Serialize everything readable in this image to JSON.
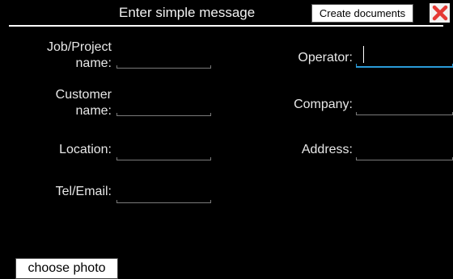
{
  "header": {
    "title": "Enter simple message",
    "create_label": "Create documents"
  },
  "left_fields": {
    "job_project_line1": "Job/Project",
    "job_project_line2": "name:",
    "customer_line1": "Customer",
    "customer_line2": "name:",
    "location": "Location:",
    "tel_email": "Tel/Email:"
  },
  "right_fields": {
    "operator": "Operator:",
    "company": "Company:",
    "address": "Address:"
  },
  "footer": {
    "choose_photo_label": "choose photo"
  },
  "colors": {
    "background": "#000000",
    "focus_underline": "#2a9bd8",
    "close_icon": "#e53935"
  }
}
